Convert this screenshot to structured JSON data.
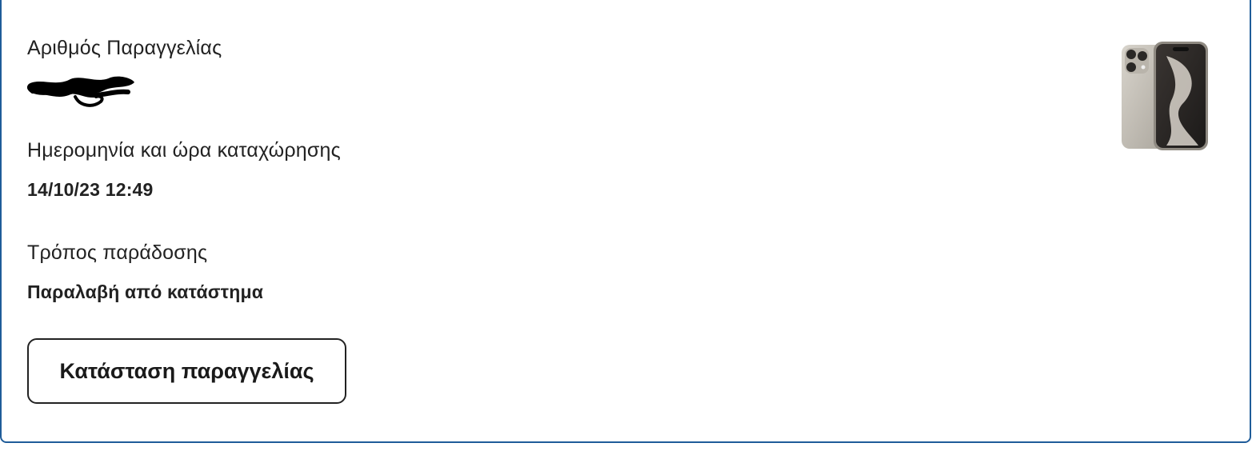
{
  "order": {
    "number_label": "Αριθμός Παραγγελίας",
    "date_label": "Ημερομηνία και ώρα καταχώρησης",
    "date_value": "14/10/23 12:49",
    "delivery_label": "Τρόπος παράδοσης",
    "delivery_value": "Παραλαβή από κατάστημα",
    "status_button": "Κατάσταση παραγγελίας"
  },
  "product": {
    "image_icon": "smartphone-image"
  },
  "colors": {
    "card_border": "#1f5c99",
    "text": "#222222"
  }
}
